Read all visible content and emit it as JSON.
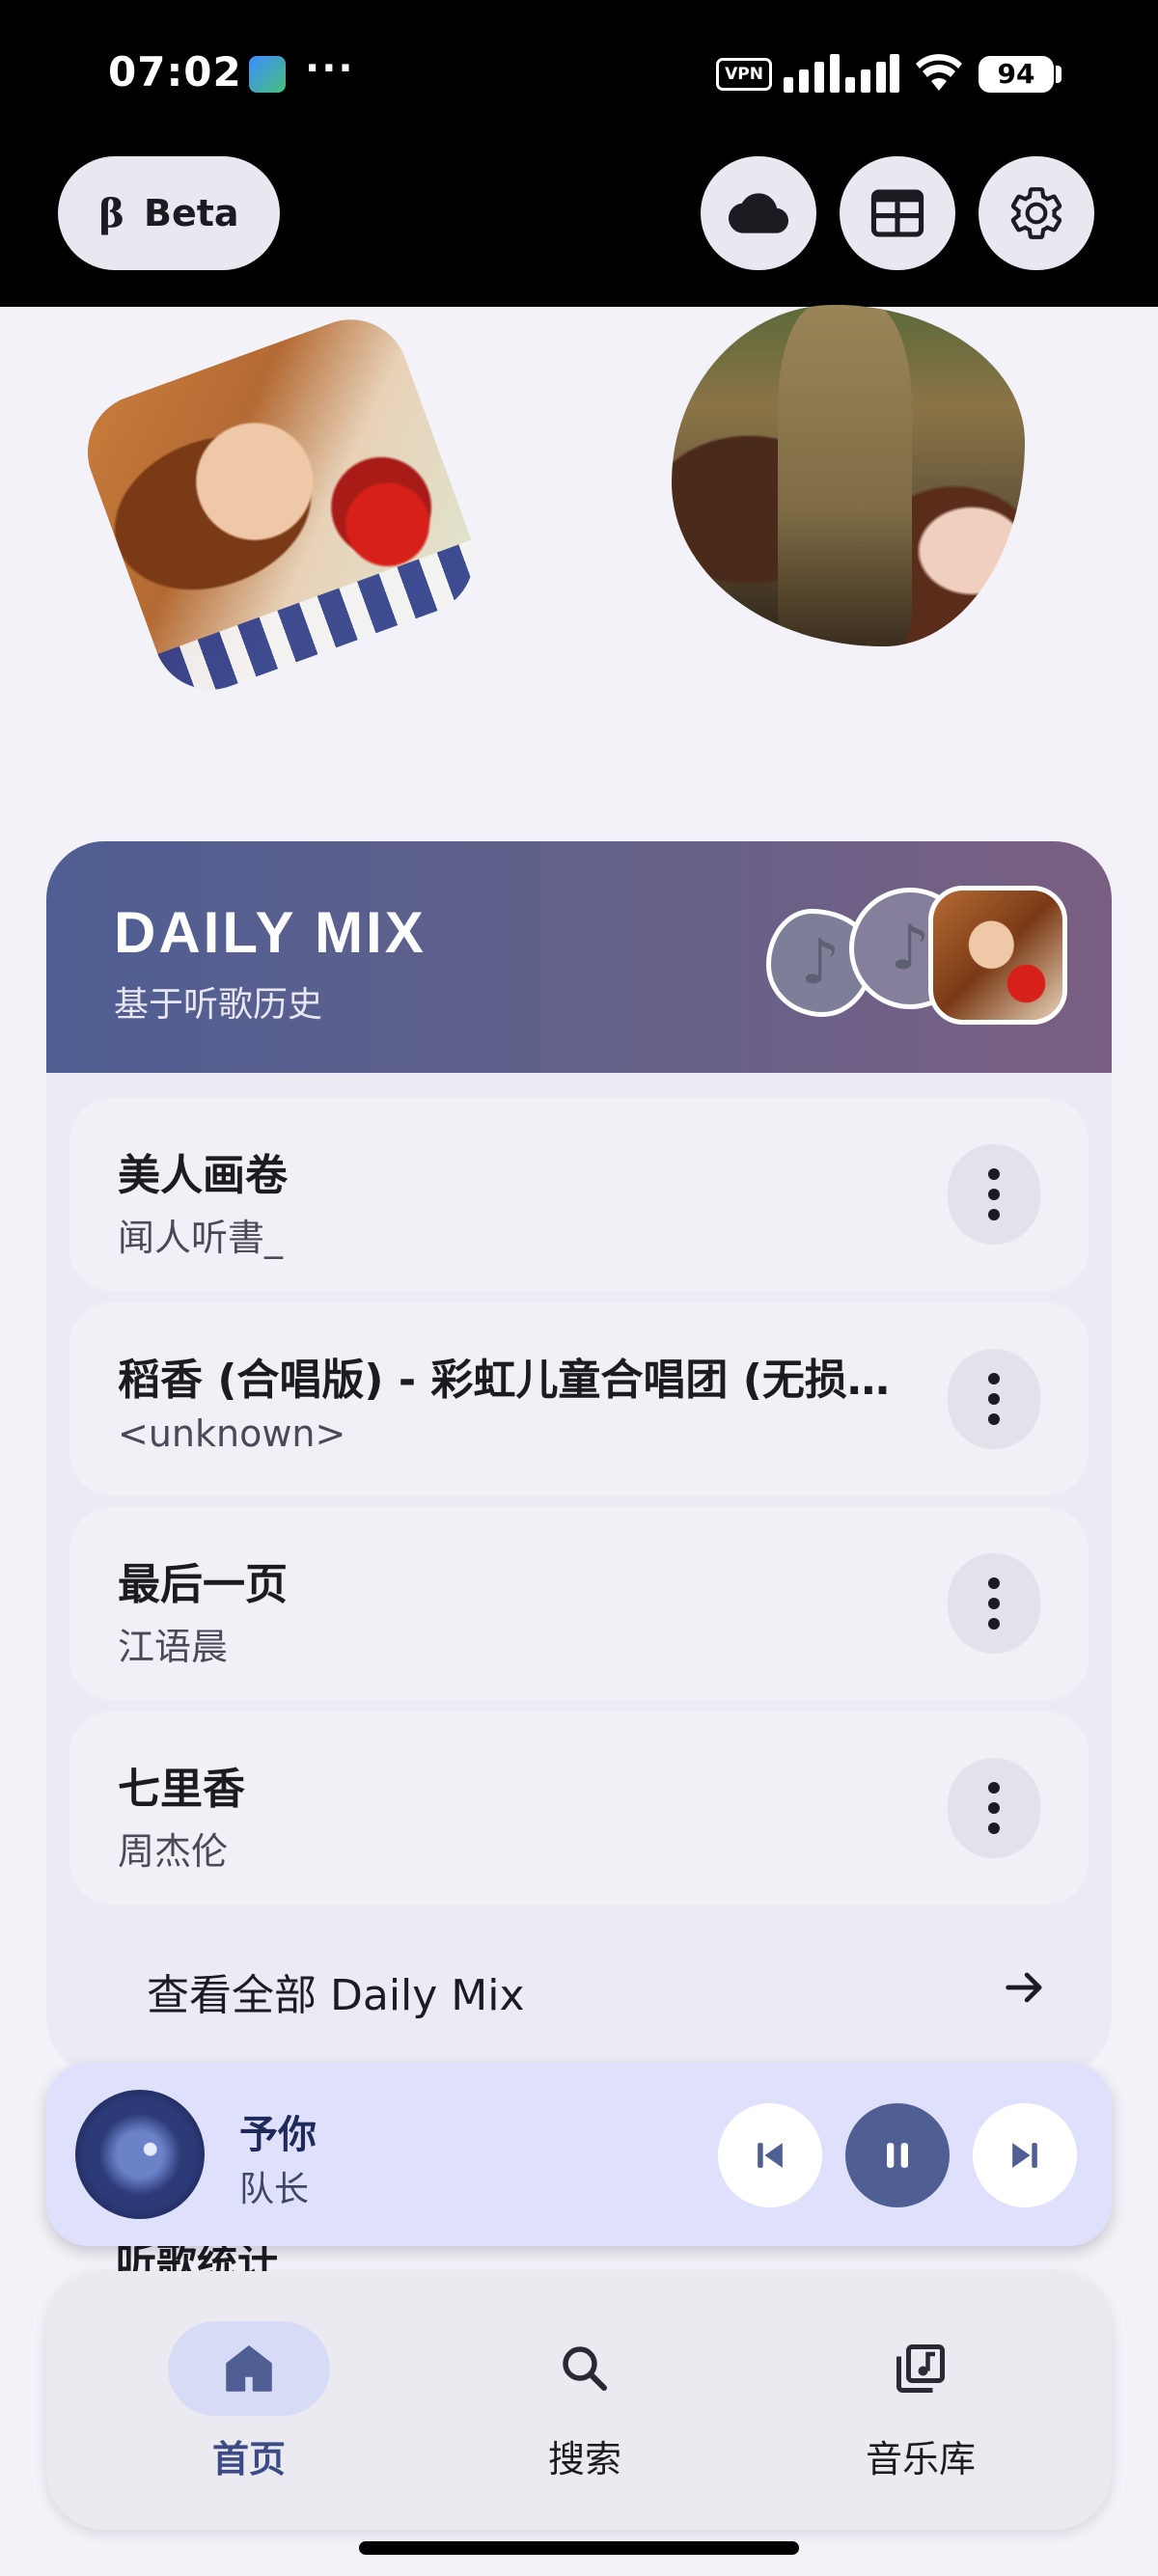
{
  "status_bar": {
    "time": "07:02",
    "dots": "···",
    "vpn": "VPN",
    "battery": "94",
    "icons": [
      "gallery-app-icon",
      "signal-icon",
      "wifi-icon",
      "battery-icon"
    ]
  },
  "top_bar": {
    "beta_symbol": "β",
    "beta_label": "Beta",
    "actions": [
      "cloud-icon",
      "calendar-grid-icon",
      "settings-gear-icon"
    ]
  },
  "daily_mix": {
    "title": "DAILY MIX",
    "subtitle": "基于听歌历史",
    "tracks": [
      {
        "title": "美人画卷",
        "artist": "闻人听書_"
      },
      {
        "title": "稻香 (合唱版) - 彩虹儿童合唱团 (无损音质)",
        "artist": "<unknown>"
      },
      {
        "title": "最后一页",
        "artist": "江语晨"
      },
      {
        "title": "七里香",
        "artist": "周杰伦"
      }
    ],
    "see_all": "查看全部 Daily Mix"
  },
  "next_section_peek": "听歌统计",
  "mini_player": {
    "title": "予你",
    "artist": "队长",
    "state": "playing"
  },
  "bottom_nav": {
    "items": [
      {
        "label": "首页",
        "icon": "home-icon",
        "active": true
      },
      {
        "label": "搜索",
        "icon": "search-icon",
        "active": false
      },
      {
        "label": "音乐库",
        "icon": "music-library-icon",
        "active": false
      }
    ]
  },
  "colors": {
    "accent": "#4f5e93",
    "mini_player_bg": "#dfe0fb",
    "page_bg": "#f3f2f9",
    "header_gradient_start": "#4f5e93",
    "header_gradient_end": "#7a5f82"
  }
}
